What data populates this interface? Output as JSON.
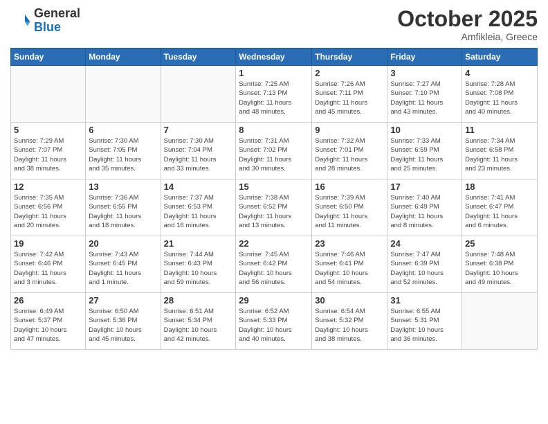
{
  "header": {
    "logo_general": "General",
    "logo_blue": "Blue",
    "month_title": "October 2025",
    "location": "Amfikleia, Greece"
  },
  "weekdays": [
    "Sunday",
    "Monday",
    "Tuesday",
    "Wednesday",
    "Thursday",
    "Friday",
    "Saturday"
  ],
  "weeks": [
    [
      {
        "day": "",
        "info": ""
      },
      {
        "day": "",
        "info": ""
      },
      {
        "day": "",
        "info": ""
      },
      {
        "day": "1",
        "info": "Sunrise: 7:25 AM\nSunset: 7:13 PM\nDaylight: 11 hours\nand 48 minutes."
      },
      {
        "day": "2",
        "info": "Sunrise: 7:26 AM\nSunset: 7:11 PM\nDaylight: 11 hours\nand 45 minutes."
      },
      {
        "day": "3",
        "info": "Sunrise: 7:27 AM\nSunset: 7:10 PM\nDaylight: 11 hours\nand 43 minutes."
      },
      {
        "day": "4",
        "info": "Sunrise: 7:28 AM\nSunset: 7:08 PM\nDaylight: 11 hours\nand 40 minutes."
      }
    ],
    [
      {
        "day": "5",
        "info": "Sunrise: 7:29 AM\nSunset: 7:07 PM\nDaylight: 11 hours\nand 38 minutes."
      },
      {
        "day": "6",
        "info": "Sunrise: 7:30 AM\nSunset: 7:05 PM\nDaylight: 11 hours\nand 35 minutes."
      },
      {
        "day": "7",
        "info": "Sunrise: 7:30 AM\nSunset: 7:04 PM\nDaylight: 11 hours\nand 33 minutes."
      },
      {
        "day": "8",
        "info": "Sunrise: 7:31 AM\nSunset: 7:02 PM\nDaylight: 11 hours\nand 30 minutes."
      },
      {
        "day": "9",
        "info": "Sunrise: 7:32 AM\nSunset: 7:01 PM\nDaylight: 11 hours\nand 28 minutes."
      },
      {
        "day": "10",
        "info": "Sunrise: 7:33 AM\nSunset: 6:59 PM\nDaylight: 11 hours\nand 25 minutes."
      },
      {
        "day": "11",
        "info": "Sunrise: 7:34 AM\nSunset: 6:58 PM\nDaylight: 11 hours\nand 23 minutes."
      }
    ],
    [
      {
        "day": "12",
        "info": "Sunrise: 7:35 AM\nSunset: 6:56 PM\nDaylight: 11 hours\nand 20 minutes."
      },
      {
        "day": "13",
        "info": "Sunrise: 7:36 AM\nSunset: 6:55 PM\nDaylight: 11 hours\nand 18 minutes."
      },
      {
        "day": "14",
        "info": "Sunrise: 7:37 AM\nSunset: 6:53 PM\nDaylight: 11 hours\nand 16 minutes."
      },
      {
        "day": "15",
        "info": "Sunrise: 7:38 AM\nSunset: 6:52 PM\nDaylight: 11 hours\nand 13 minutes."
      },
      {
        "day": "16",
        "info": "Sunrise: 7:39 AM\nSunset: 6:50 PM\nDaylight: 11 hours\nand 11 minutes."
      },
      {
        "day": "17",
        "info": "Sunrise: 7:40 AM\nSunset: 6:49 PM\nDaylight: 11 hours\nand 8 minutes."
      },
      {
        "day": "18",
        "info": "Sunrise: 7:41 AM\nSunset: 6:47 PM\nDaylight: 11 hours\nand 6 minutes."
      }
    ],
    [
      {
        "day": "19",
        "info": "Sunrise: 7:42 AM\nSunset: 6:46 PM\nDaylight: 11 hours\nand 3 minutes."
      },
      {
        "day": "20",
        "info": "Sunrise: 7:43 AM\nSunset: 6:45 PM\nDaylight: 11 hours\nand 1 minute."
      },
      {
        "day": "21",
        "info": "Sunrise: 7:44 AM\nSunset: 6:43 PM\nDaylight: 10 hours\nand 59 minutes."
      },
      {
        "day": "22",
        "info": "Sunrise: 7:45 AM\nSunset: 6:42 PM\nDaylight: 10 hours\nand 56 minutes."
      },
      {
        "day": "23",
        "info": "Sunrise: 7:46 AM\nSunset: 6:41 PM\nDaylight: 10 hours\nand 54 minutes."
      },
      {
        "day": "24",
        "info": "Sunrise: 7:47 AM\nSunset: 6:39 PM\nDaylight: 10 hours\nand 52 minutes."
      },
      {
        "day": "25",
        "info": "Sunrise: 7:48 AM\nSunset: 6:38 PM\nDaylight: 10 hours\nand 49 minutes."
      }
    ],
    [
      {
        "day": "26",
        "info": "Sunrise: 6:49 AM\nSunset: 5:37 PM\nDaylight: 10 hours\nand 47 minutes."
      },
      {
        "day": "27",
        "info": "Sunrise: 6:50 AM\nSunset: 5:36 PM\nDaylight: 10 hours\nand 45 minutes."
      },
      {
        "day": "28",
        "info": "Sunrise: 6:51 AM\nSunset: 5:34 PM\nDaylight: 10 hours\nand 42 minutes."
      },
      {
        "day": "29",
        "info": "Sunrise: 6:52 AM\nSunset: 5:33 PM\nDaylight: 10 hours\nand 40 minutes."
      },
      {
        "day": "30",
        "info": "Sunrise: 6:54 AM\nSunset: 5:32 PM\nDaylight: 10 hours\nand 38 minutes."
      },
      {
        "day": "31",
        "info": "Sunrise: 6:55 AM\nSunset: 5:31 PM\nDaylight: 10 hours\nand 36 minutes."
      },
      {
        "day": "",
        "info": ""
      }
    ]
  ]
}
